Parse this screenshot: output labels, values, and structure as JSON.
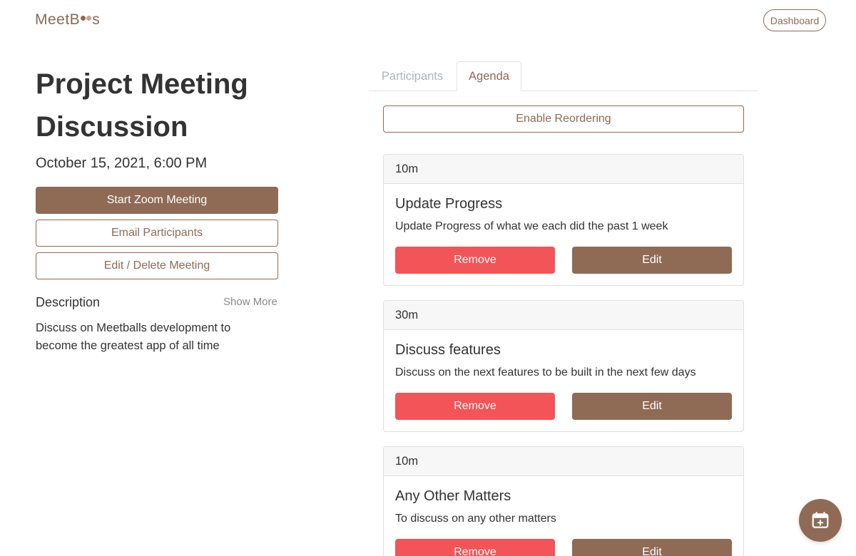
{
  "header": {
    "logo_text_prefix": "MeetB",
    "logo_text_suffix": "s",
    "dashboard_label": "Dashboard"
  },
  "meeting": {
    "title": "Project Meeting Discussion",
    "datetime": "October 15, 2021, 6:00 PM",
    "start_zoom_label": "Start Zoom Meeting",
    "email_participants_label": "Email Participants",
    "edit_delete_label": "Edit / Delete Meeting",
    "description_label": "Description",
    "show_more_label": "Show More",
    "description_text": "Discuss on Meetballs development to become the greatest app of all time"
  },
  "tabs": [
    {
      "label": "Participants",
      "active": false
    },
    {
      "label": "Agenda",
      "active": true
    }
  ],
  "agenda": {
    "reorder_label": "Enable Reordering",
    "items": [
      {
        "duration": "10m",
        "title": "Update Progress",
        "description": "Update Progress of what we each did the past 1 week",
        "remove_label": "Remove",
        "edit_label": "Edit"
      },
      {
        "duration": "30m",
        "title": "Discuss features",
        "description": "Discuss on the next features to be built in the next few days",
        "remove_label": "Remove",
        "edit_label": "Edit"
      },
      {
        "duration": "10m",
        "title": "Any Other Matters",
        "description": "To discuss on any other matters",
        "remove_label": "Remove",
        "edit_label": "Edit"
      }
    ]
  },
  "fab": {
    "icon": "calendar-add-icon"
  },
  "colors": {
    "brand": "#8f6a55",
    "remove": "#f35457",
    "card_header_bg": "#f7f7f7",
    "muted": "#adb5bd"
  }
}
